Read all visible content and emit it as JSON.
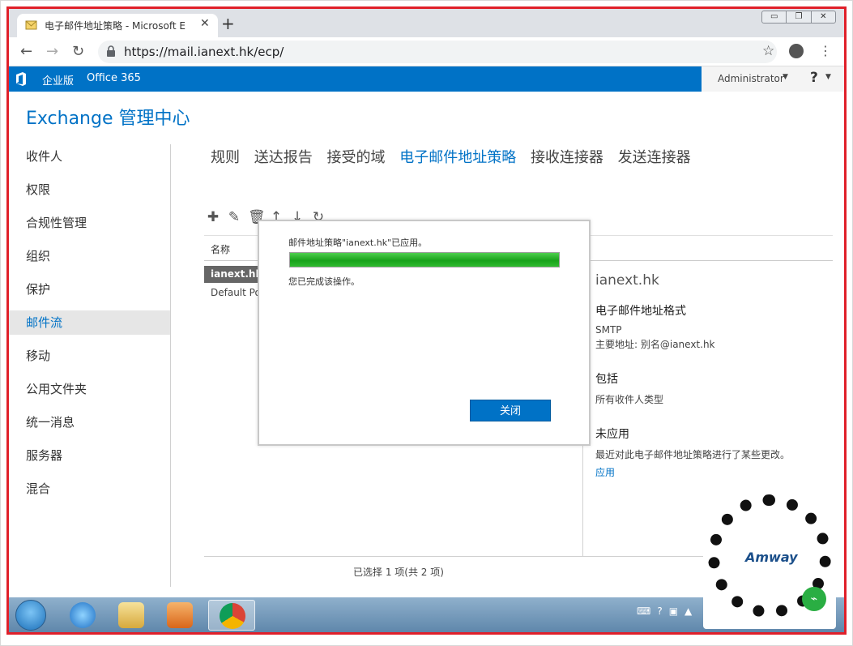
{
  "browser": {
    "tab_title": "电子邮件地址策略 - Microsoft E",
    "tab_close": "✕",
    "new_tab": "+",
    "url": "https://mail.ianext.hk/ecp/",
    "controls": [
      "▭",
      "❐",
      "✕"
    ]
  },
  "officebar": {
    "edition": "企业版",
    "product": "Office 365",
    "user": "Administrator",
    "help": "?"
  },
  "page": {
    "title": "Exchange 管理中心"
  },
  "leftnav": {
    "items": [
      {
        "label": "收件人"
      },
      {
        "label": "权限"
      },
      {
        "label": "合规性管理"
      },
      {
        "label": "组织"
      },
      {
        "label": "保护"
      },
      {
        "label": "邮件流",
        "selected": true
      },
      {
        "label": "移动"
      },
      {
        "label": "公用文件夹"
      },
      {
        "label": "统一消息"
      },
      {
        "label": "服务器"
      },
      {
        "label": "混合"
      }
    ]
  },
  "subtabs": [
    {
      "label": "规则"
    },
    {
      "label": "送达报告"
    },
    {
      "label": "接受的域"
    },
    {
      "label": "电子邮件地址策略",
      "active": true
    },
    {
      "label": "接收连接器"
    },
    {
      "label": "发送连接器"
    }
  ],
  "list": {
    "column_name": "名称",
    "rows": [
      "ianext.hk",
      "Default Pol"
    ],
    "status": "已选择 1 项(共 2 项)"
  },
  "detail": {
    "name": "ianext.hk",
    "format_heading": "电子邮件地址格式",
    "format_type": "SMTP",
    "format_primary": "主要地址: 别名@ianext.hk",
    "include_heading": "包括",
    "include_text": "所有收件人类型",
    "unapplied_heading": "未应用",
    "unapplied_text": "最近对此电子邮件地址策略进行了某些更改。",
    "apply_link": "应用"
  },
  "dialog": {
    "message": "邮件地址策略\"ianext.hk\"已应用。",
    "progress": 1.0,
    "sub_message": "您已完成该操作。",
    "close_button": "关闭"
  },
  "qr": {
    "logo_text": "Amway"
  },
  "colors": {
    "accent": "#0072c6",
    "border": "#e0202a",
    "progress": "#19a21b"
  }
}
